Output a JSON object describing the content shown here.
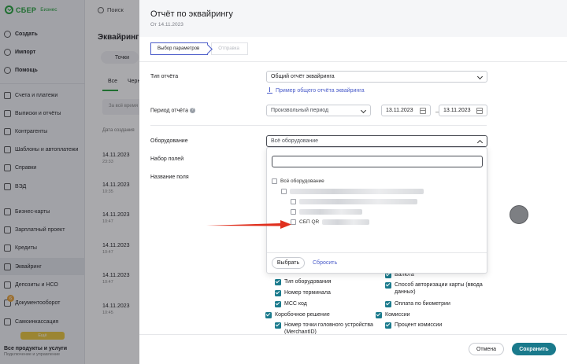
{
  "app": {
    "logo_name": "СБЕР",
    "logo_sub": "Бизнес",
    "search_label": "Поиск",
    "colors": {
      "brand": "#21a038",
      "accent": "#1a7a8c",
      "link": "#4a5cc9",
      "annotation_arrow": "#e0301e"
    }
  },
  "sidebar": {
    "items": [
      {
        "label": "Создать",
        "icon": "plus-icon"
      },
      {
        "label": "Импорт",
        "icon": "import-icon"
      },
      {
        "label": "Помощь",
        "icon": "help-icon"
      },
      {
        "label": "Счета и платежи",
        "icon": "wallet-icon"
      },
      {
        "label": "Выписки и отчёты",
        "icon": "report-icon"
      },
      {
        "label": "Контрагенты",
        "icon": "contacts-icon"
      },
      {
        "label": "Шаблоны и автоплатежи",
        "icon": "template-icon"
      },
      {
        "label": "Справки",
        "icon": "certificate-icon"
      },
      {
        "label": "ВЭД",
        "icon": "globe-icon"
      },
      {
        "label": "Бизнес-карты",
        "icon": "card-icon"
      },
      {
        "label": "Зарплатный проект",
        "icon": "salary-icon"
      },
      {
        "label": "Кредиты",
        "icon": "credit-icon"
      },
      {
        "label": "Эквайринг",
        "icon": "acquiring-icon"
      },
      {
        "label": "Депозиты и НСО",
        "icon": "deposit-icon"
      },
      {
        "label": "Документооборот",
        "icon": "documents-icon"
      },
      {
        "label": "Самоинкассация",
        "icon": "cash-icon"
      }
    ],
    "badge": "6",
    "more_label": "Ещё",
    "products_title": "Все продукты и услуги",
    "products_sub": "Подключение и управление"
  },
  "background": {
    "page_title": "Эквайринг",
    "tab_label": "Точки",
    "filter_all": "Все",
    "filter_second": "Черн",
    "filter_placeholder": "За всё время",
    "column_created": "Дата создания",
    "rows": [
      {
        "date": "14.11.2023",
        "time": "23:33"
      },
      {
        "date": "14.11.2023",
        "time": "10:35"
      },
      {
        "date": "14.11.2023",
        "time": "10:47"
      },
      {
        "date": "14.11.2023",
        "time": "10:47"
      },
      {
        "date": "14.11.2023",
        "time": "10:47"
      },
      {
        "date": "14.11.2023",
        "time": "10:45"
      }
    ]
  },
  "drawer": {
    "title": "Отчёт по эквайрингу",
    "subtitle": "От 14.11.2023",
    "steps": [
      "Выбор параметров",
      "Отправка"
    ],
    "report_type_label": "Тип отчёта",
    "report_type_value": "Общий отчёт эквайринга",
    "example_link": "Пример общего отчёта эквайринга",
    "period_label": "Период отчёта",
    "period_value": "Произвольный период",
    "date_from": "13.11.2023",
    "date_to": "13.11.2023",
    "equipment_label": "Оборудование",
    "equipment_value": "Всё оборудование",
    "fields_set_label": "Набор полей",
    "field_name_label": "Название поля",
    "dropdown": {
      "search_value": "",
      "all_option": "Всё оборудование",
      "last_option": "СБП QR",
      "select_button": "Выбрать",
      "reset_link": "Сбросить"
    },
    "checkboxes_left": [
      {
        "label": "Тип оборудования",
        "checked": true
      },
      {
        "label": "Номер терминала",
        "checked": true
      },
      {
        "label": "MCC код",
        "checked": true
      },
      {
        "label": "Коробочное решение",
        "checked": true
      },
      {
        "label": "Номер точки головного устройства (MerchantID)",
        "checked": true
      }
    ],
    "checkboxes_right": [
      {
        "label": "Валюта",
        "checked": true
      },
      {
        "label": "Способ авторизации карты (ввода данных)",
        "checked": true
      },
      {
        "label": "Оплата по биометрии",
        "checked": true
      },
      {
        "label": "Комиссии",
        "checked": true
      },
      {
        "label": "Процент комиссии",
        "checked": true
      }
    ],
    "cancel_button": "Отмена",
    "save_button": "Сохранить"
  }
}
